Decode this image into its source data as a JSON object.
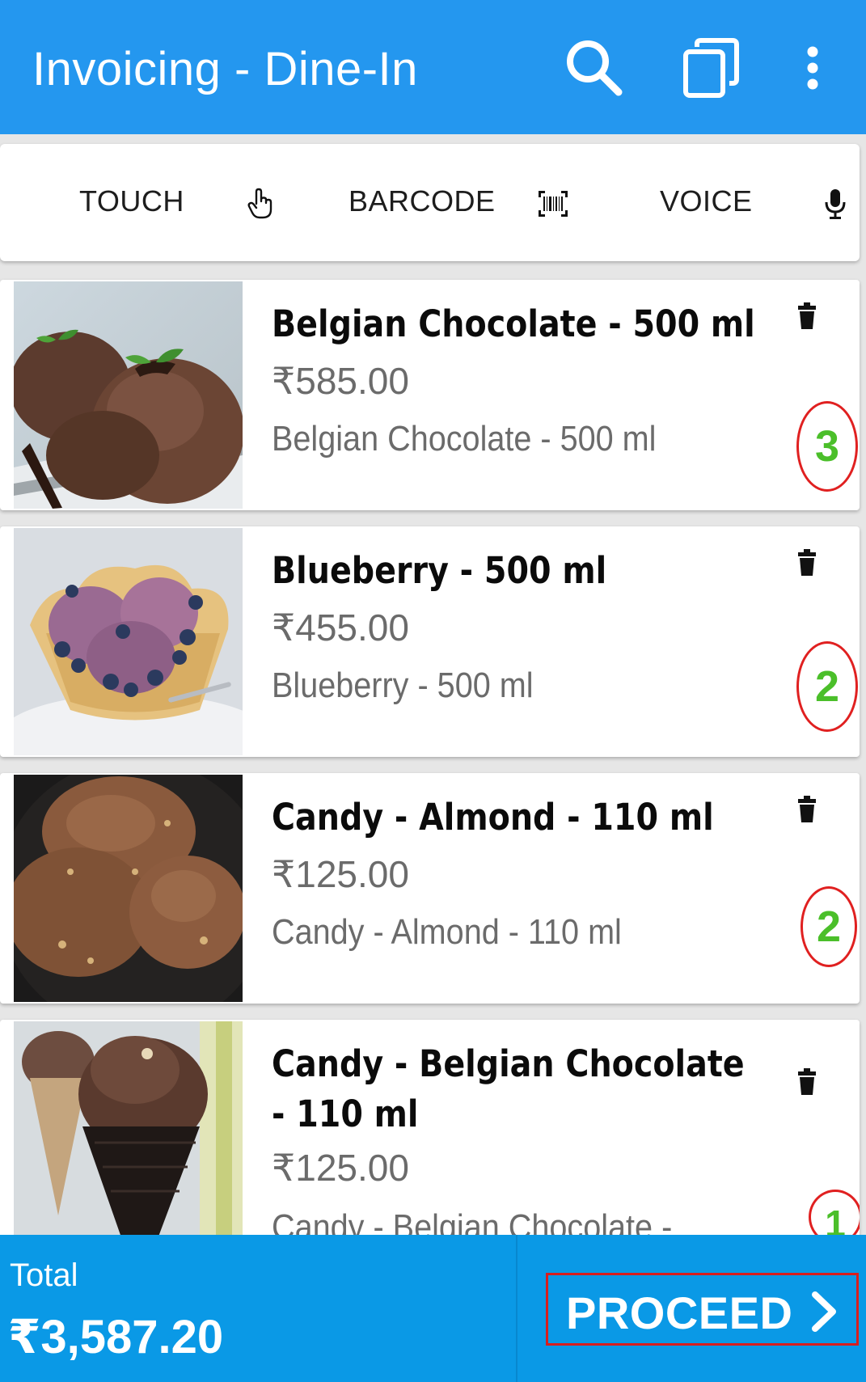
{
  "appbar": {
    "title": "Invoicing - Dine-In",
    "icons": [
      "search-icon",
      "copy-icon",
      "more-vert-icon"
    ],
    "color": "#2497ef"
  },
  "modes": [
    {
      "label": "TOUCH",
      "icon": "touch-hand-icon"
    },
    {
      "label": "BARCODE",
      "icon": "barcode-icon"
    },
    {
      "label": "VOICE",
      "icon": "microphone-icon"
    }
  ],
  "items": [
    {
      "name": "Belgian Chocolate - 500 ml",
      "price": "₹585.00",
      "description": "Belgian Chocolate - 500 ml",
      "quantity": "3",
      "image": "chocolate-ice-cream-tub"
    },
    {
      "name": "Blueberry - 500 ml",
      "price": "₹455.00",
      "description": "Blueberry - 500 ml",
      "quantity": "2",
      "image": "blueberry-ice-cream-waffle-bowl"
    },
    {
      "name": "Candy - Almond - 110 ml",
      "price": "₹125.00",
      "description": "Candy - Almond - 110 ml",
      "quantity": "2",
      "image": "almond-ice-cream-scoops"
    },
    {
      "name": "Candy - Belgian Chocolate - 110 ml",
      "price": "₹125.00",
      "description": "Candy - Belgian Chocolate -",
      "quantity": "1",
      "image": "chocolate-ice-cream-cone"
    }
  ],
  "footer": {
    "total_label": "Total",
    "total_value": "₹3,587.20",
    "proceed_label": "PROCEED",
    "color": "#0a99e6"
  },
  "colors": {
    "quantity_text": "#4bbf2a",
    "annotation_red": "#e02020"
  }
}
